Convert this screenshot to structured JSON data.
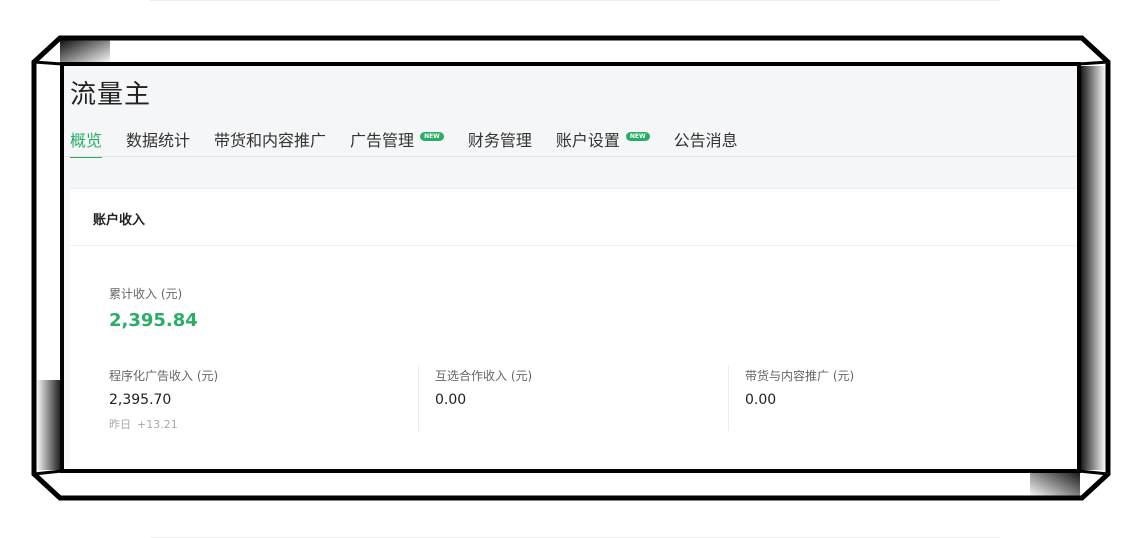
{
  "app": {
    "title": "流量主"
  },
  "tabs": [
    {
      "label": "概览",
      "active": true
    },
    {
      "label": "数据统计"
    },
    {
      "label": "带货和内容推广"
    },
    {
      "label": "广告管理",
      "badge": "NEW"
    },
    {
      "label": "财务管理"
    },
    {
      "label": "账户设置",
      "badge": "NEW"
    },
    {
      "label": "公告消息"
    }
  ],
  "card": {
    "title": "账户收入",
    "total": {
      "label": "累计收入 (元)",
      "value": "2,395.84"
    },
    "metrics": [
      {
        "label": "程序化广告收入 (元)",
        "value": "2,395.70",
        "sub_label": "昨日",
        "sub_value": "+13.21"
      },
      {
        "label": "互选合作收入 (元)",
        "value": "0.00"
      },
      {
        "label": "带货与内容推广 (元)",
        "value": "0.00"
      }
    ]
  },
  "colors": {
    "accent": "#2aae67",
    "frame": "#000000",
    "panel_bg": "#f5f6f7"
  }
}
